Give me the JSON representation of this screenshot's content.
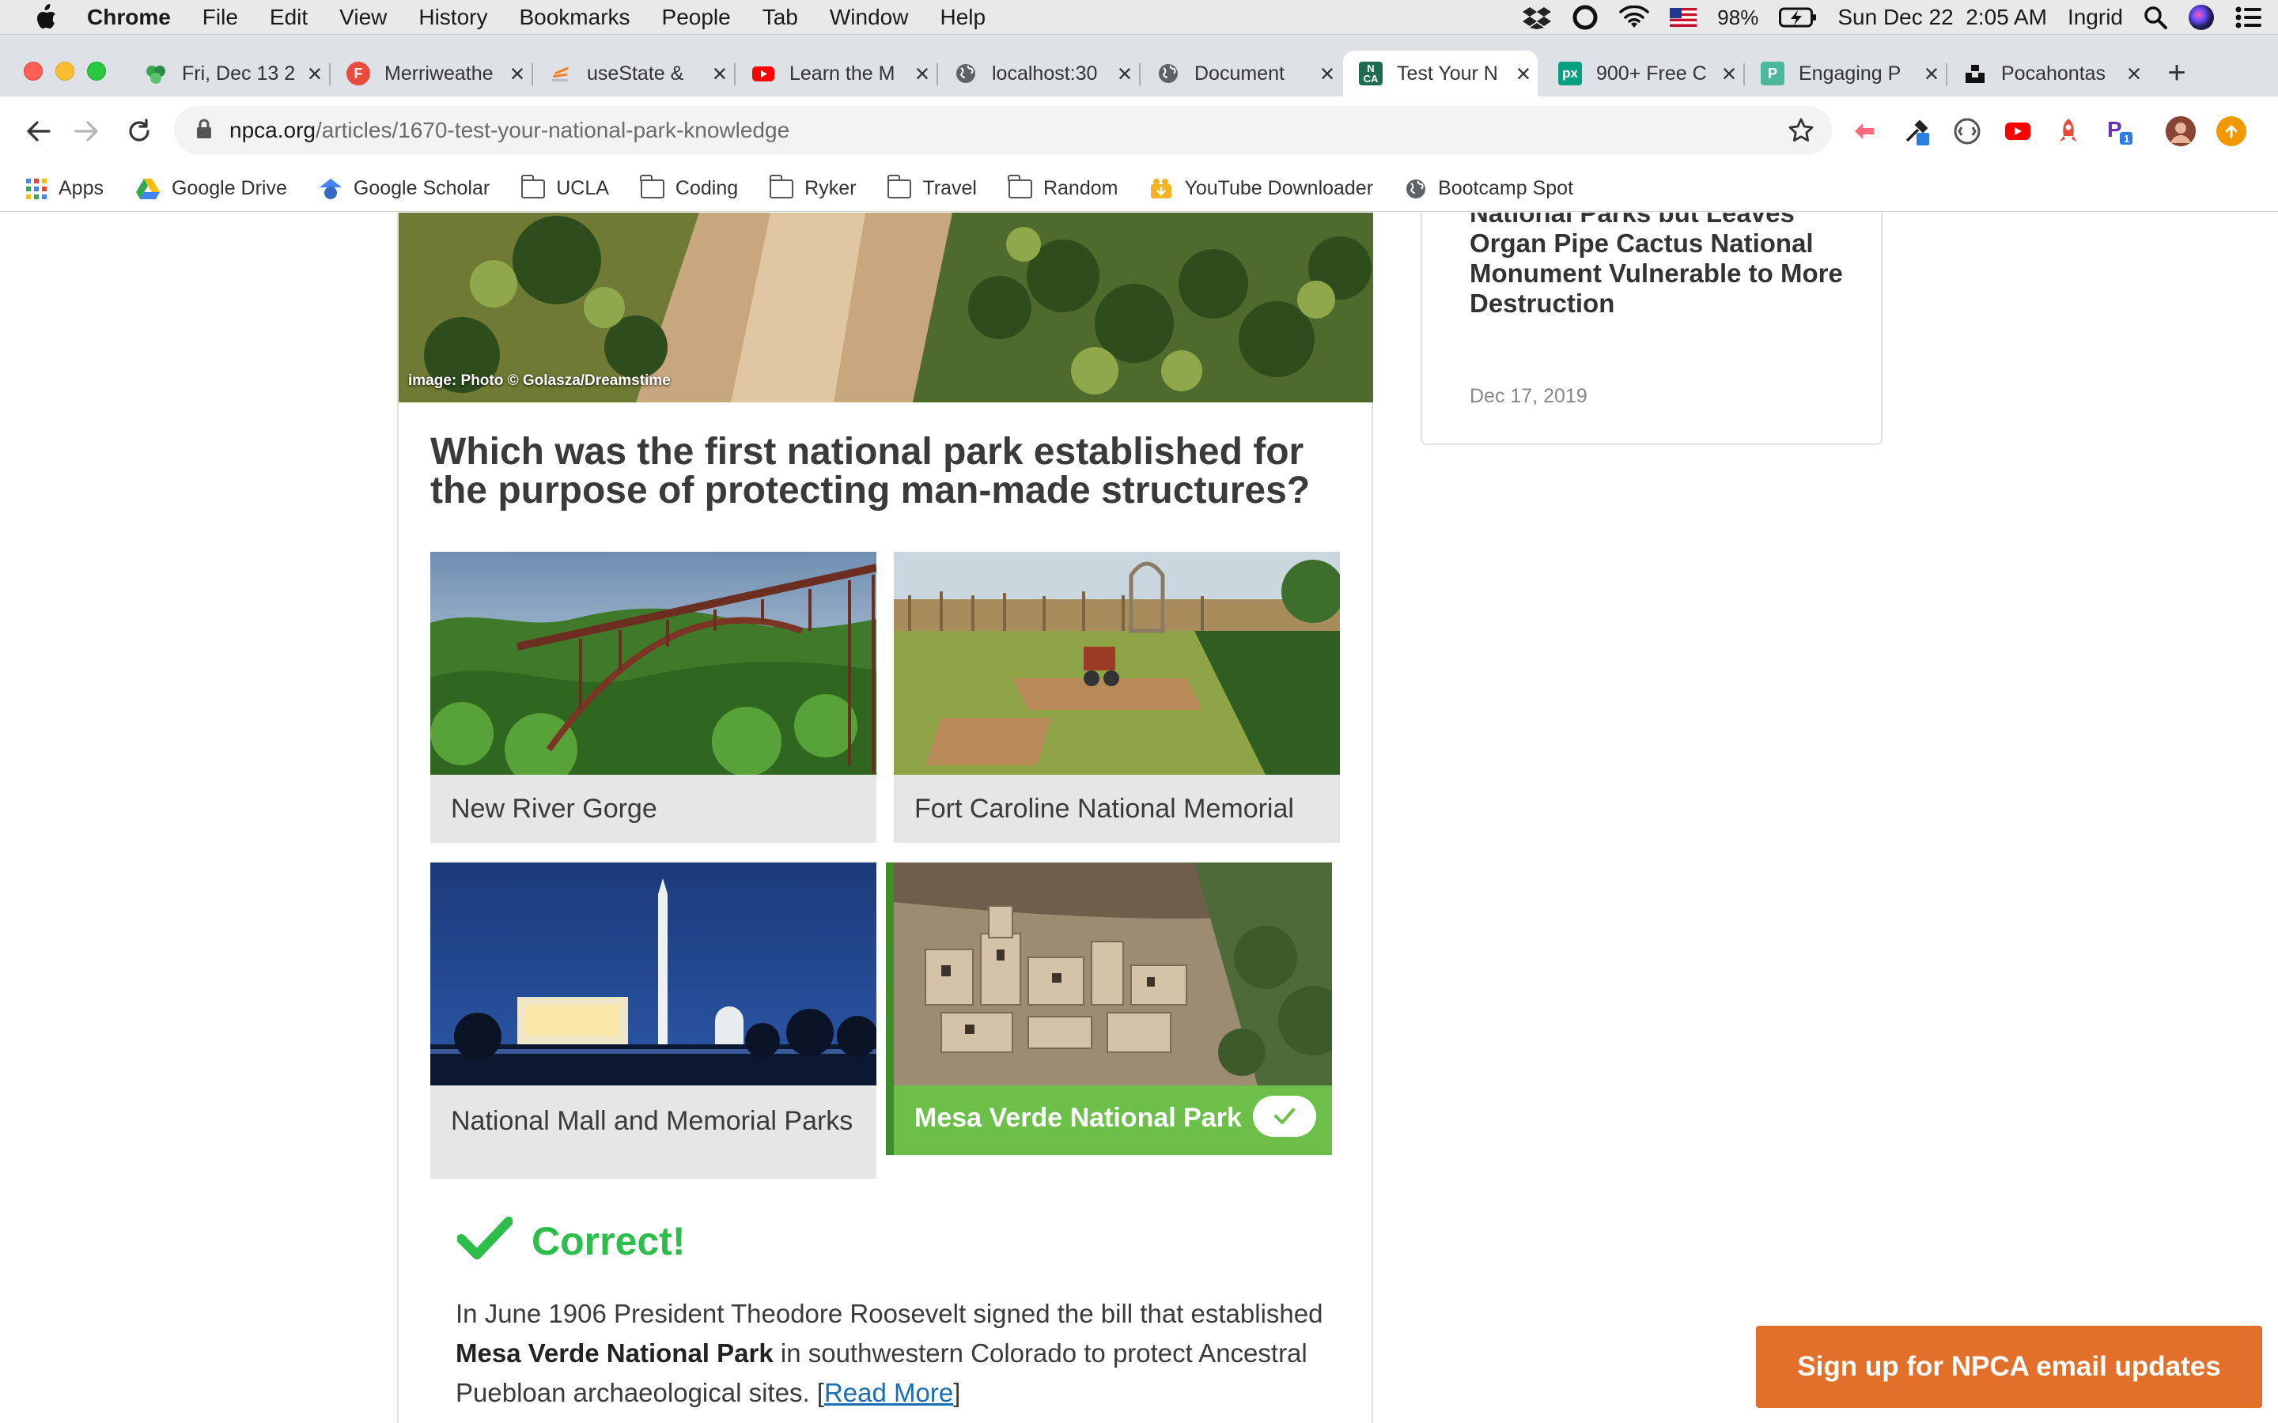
{
  "menubar": {
    "app_name": "Chrome",
    "menus": [
      "File",
      "Edit",
      "View",
      "History",
      "Bookmarks",
      "People",
      "Tab",
      "Window",
      "Help"
    ],
    "battery": "98%",
    "clock": "Sun Dec 22  2:05 AM",
    "user": "Ingrid"
  },
  "tabs": [
    {
      "title": "Fri, Dec 13 2",
      "favicon": "green-circles-icon",
      "color": "#34a853"
    },
    {
      "title": "Merriweathe",
      "favicon": "f-letter-icon",
      "color": "#e94b3c"
    },
    {
      "title": "useState &",
      "favicon": "stack-icon",
      "color": "#f48024"
    },
    {
      "title": "Learn the M",
      "favicon": "youtube-icon",
      "color": "#ff0000"
    },
    {
      "title": "localhost:30",
      "favicon": "globe-icon",
      "color": "#5f6368"
    },
    {
      "title": "Document",
      "favicon": "globe-icon",
      "color": "#5f6368"
    },
    {
      "title": "Test Your N",
      "favicon": "npca-icon",
      "color": "#1e6b52"
    },
    {
      "title": "900+ Free C",
      "favicon": "px-icon",
      "color": "#05a081"
    },
    {
      "title": "Engaging P",
      "favicon": "doc-icon",
      "color": "#4bb89c"
    },
    {
      "title": "Pocahontas",
      "favicon": "unsplash-icon",
      "color": "#111111"
    }
  ],
  "active_tab_index": 6,
  "address": {
    "host": "npca.org",
    "path": "/articles/1670-test-your-national-park-knowledge"
  },
  "bookmarks": [
    {
      "label": "Apps",
      "icon": "apps-grid-icon"
    },
    {
      "label": "Google Drive",
      "icon": "google-drive-icon"
    },
    {
      "label": "Google Scholar",
      "icon": "google-scholar-icon"
    },
    {
      "label": "UCLA",
      "icon": "folder-icon"
    },
    {
      "label": "Coding",
      "icon": "folder-icon"
    },
    {
      "label": "Ryker",
      "icon": "folder-icon"
    },
    {
      "label": "Travel",
      "icon": "folder-icon"
    },
    {
      "label": "Random",
      "icon": "folder-icon"
    },
    {
      "label": "YouTube Downloader",
      "icon": "download-icon"
    },
    {
      "label": "Bootcamp Spot",
      "icon": "globe-icon"
    }
  ],
  "article": {
    "hero_caption": "image: Photo © Golasza/Dreamstime",
    "question": "Which was the first national park established for the purpose of protecting man-made structures?",
    "answers": [
      {
        "label": "New River Gorge",
        "correct": false
      },
      {
        "label": "Fort Caroline National Memorial",
        "correct": false
      },
      {
        "label": "National Mall and Memorial Parks",
        "correct": false
      },
      {
        "label": "Mesa Verde National Park",
        "correct": true
      }
    ],
    "result_label": "Correct!",
    "explanation": {
      "before": "In June 1906 President Theodore Roosevelt signed the bill that established ",
      "bold": "Mesa Verde National Park",
      "after": " in southwestern Colorado to protect Ancestral Puebloan archaeological sites. [",
      "link": "Read More",
      "end": "]"
    }
  },
  "sidebar": {
    "headline": "National Parks but Leaves Organ Pipe Cactus National Monument Vulnerable to More Destruction",
    "date": "Dec 17, 2019"
  },
  "signup_label": "Sign up for NPCA email updates",
  "colors": {
    "correct_green": "#6cc04a",
    "correct_text": "#2ebd4a",
    "signup_orange": "#e3702a",
    "link_blue": "#1a6db5"
  }
}
